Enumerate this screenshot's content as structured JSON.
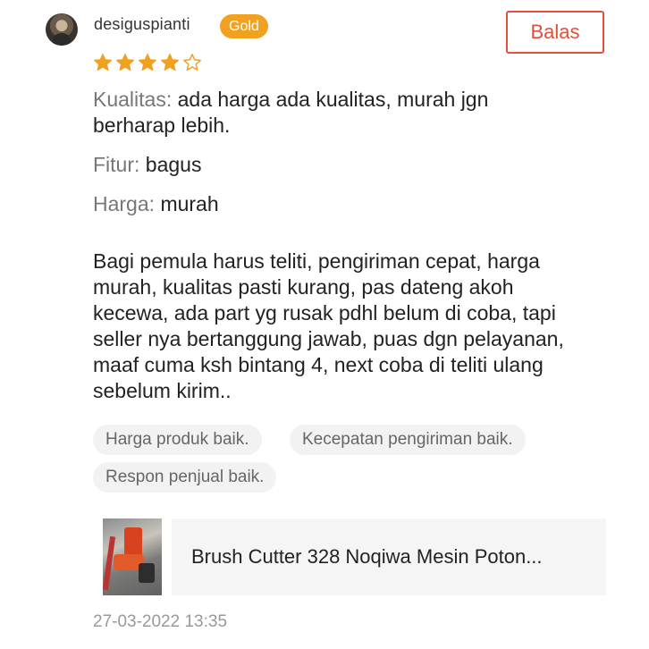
{
  "review": {
    "user": {
      "name": "desiguspianti",
      "badge": "Gold"
    },
    "reply_label": "Balas",
    "rating": 4,
    "rating_max": 5,
    "star_color": "#f0a11f",
    "attributes": [
      {
        "label": "Kualitas:",
        "value": "ada harga ada kualitas, murah jgn\nberharap lebih."
      },
      {
        "label": "Fitur:",
        "value": "bagus"
      },
      {
        "label": "Harga:",
        "value": "murah"
      }
    ],
    "text": "Bagi pemula harus teliti, pengiriman cepat, harga\nmurah, kualitas pasti kurang, pas dateng akoh\nkecewa, ada part yg rusak pdhl belum di coba, tapi\nseller nya bertanggung jawab, puas dgn pelayanan,\nmaaf cuma ksh bintang 4, next coba di teliti ulang\nsebelum kirim..",
    "tags": [
      "Harga produk baik.",
      "Kecepatan pengiriman baik.",
      "Respon penjual baik."
    ],
    "product": {
      "title": "Brush Cutter 328 Noqiwa Mesin Poton..."
    },
    "timestamp": "27-03-2022 13:35"
  },
  "colors": {
    "accent": "#e0503c",
    "badge": "#f0a11f",
    "label_gray": "#777777",
    "tag_bg": "#f2f2f2"
  }
}
